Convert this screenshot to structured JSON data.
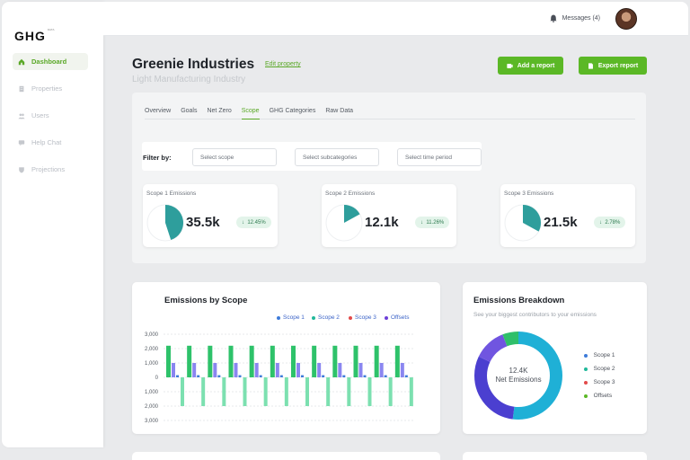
{
  "logo": {
    "text": "GHG",
    "sub": "DATA"
  },
  "sidebar": {
    "items": [
      {
        "label": "Dashboard",
        "icon": "home-icon",
        "active": true
      },
      {
        "label": "Properties",
        "icon": "building-icon",
        "active": false
      },
      {
        "label": "Users",
        "icon": "users-icon",
        "active": false
      },
      {
        "label": "Help Chat",
        "icon": "chat-icon",
        "active": false
      },
      {
        "label": "Projections",
        "icon": "shield-icon",
        "active": false
      }
    ]
  },
  "topbar": {
    "messages_label": "Messages (4)"
  },
  "header": {
    "title": "Greenie Industries",
    "edit_link": "Edit property",
    "subtitle": "Light Manufacturing Industry",
    "add_report": "Add a report",
    "export_report": "Export report"
  },
  "tabs": [
    "Overview",
    "Goals",
    "Net Zero",
    "Scope",
    "GHG Categories",
    "Raw Data"
  ],
  "active_tab": "Scope",
  "filter": {
    "label": "Filter by:",
    "scope_placeholder": "Select scope",
    "subcategory_placeholder": "Select subcategories",
    "period_placeholder": "Select time period"
  },
  "cards": [
    {
      "label": "Scope 1 Emissions",
      "value": "35.5k",
      "delta": "12.45%",
      "share": 0.45
    },
    {
      "label": "Scope 2 Emissions",
      "value": "12.1k",
      "delta": "11.26%",
      "share": 0.17
    },
    {
      "label": "Scope 3 Emissions",
      "value": "21.5k",
      "delta": "2.78%",
      "share": 0.33
    }
  ],
  "colors": {
    "accent": "#5bb826",
    "teal": "#2e9e9c",
    "scope1": "#3d7bd9",
    "scope2": "#20b89a",
    "scope3": "#e24a4a",
    "offsets": "#6d3fd8"
  },
  "emissions_chart": {
    "title": "Emissions by Scope",
    "legend": [
      "Scope 1",
      "Scope 2",
      "Scope 3",
      "Offsets"
    ]
  },
  "chart_data": [
    {
      "type": "bar",
      "title": "Emissions by Scope",
      "ytick_labels": [
        "3,000",
        "2,000",
        "1,000",
        "0",
        "1,000",
        "2,000",
        "3,000"
      ],
      "ylim": [
        -3000,
        3000
      ],
      "series": [
        {
          "name": "Scope 1",
          "values": [
            2200,
            2200,
            2200,
            2200,
            2200,
            2200,
            2200,
            2200,
            2200,
            2200,
            2200,
            2200
          ]
        },
        {
          "name": "Scope 2",
          "values": [
            1000,
            1000,
            1000,
            1000,
            1000,
            1000,
            1000,
            1000,
            1000,
            1000,
            1000,
            1000
          ]
        },
        {
          "name": "Scope 3",
          "values": [
            150,
            150,
            150,
            150,
            150,
            150,
            150,
            150,
            150,
            150,
            150,
            150
          ]
        },
        {
          "name": "Offsets",
          "values": [
            -2000,
            -2000,
            -2000,
            -2000,
            -2000,
            -2000,
            -2000,
            -2000,
            -2000,
            -2000,
            -2000,
            -2000
          ]
        }
      ],
      "grid": true,
      "legend_position": "top-right"
    },
    {
      "type": "pie",
      "title": "Emissions Breakdown",
      "subtitle": "See your biggest contributors to your emissions",
      "center_value": "12.4K",
      "center_label": "Net Emissions",
      "categories": [
        "Scope 1",
        "Scope 2",
        "Scope 3",
        "Offsets"
      ],
      "values": [
        52,
        30,
        12,
        6
      ],
      "segment_colors": [
        "#1fb0d6",
        "#4b3fd0",
        "#7055e0",
        "#2fbf6a"
      ]
    }
  ],
  "breakdown": {
    "title": "Emissions Breakdown",
    "subtitle": "See your biggest contributors to your emissions",
    "center_value": "12.4K",
    "center_label": "Net Emissions",
    "legend": [
      "Scope 1",
      "Scope 2",
      "Scope 3",
      "Offsets"
    ]
  }
}
